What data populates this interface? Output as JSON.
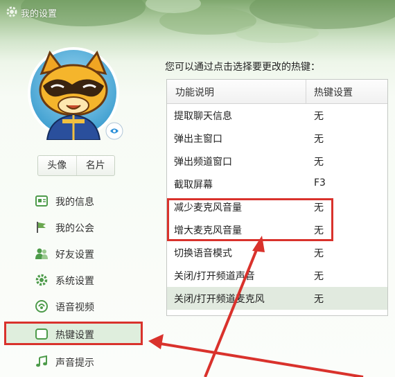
{
  "window": {
    "title": "我的设置"
  },
  "sidebar": {
    "avatar_tabs": [
      "头像",
      "名片"
    ],
    "items": [
      {
        "label": "我的信息",
        "icon": "profile-card-icon"
      },
      {
        "label": "我的公会",
        "icon": "flag-icon"
      },
      {
        "label": "好友设置",
        "icon": "friends-icon"
      },
      {
        "label": "系统设置",
        "icon": "gear-icon"
      },
      {
        "label": "语音视频",
        "icon": "voice-video-icon"
      },
      {
        "label": "热键设置",
        "icon": "keyboard-icon",
        "active": true
      },
      {
        "label": "声音提示",
        "icon": "music-note-icon"
      }
    ]
  },
  "main": {
    "hint": "您可以通过点击选择要更改的热键：",
    "columns": [
      "功能说明",
      "热键设置"
    ],
    "rows": [
      {
        "function": "提取聊天信息",
        "hotkey": "无"
      },
      {
        "function": "弹出主窗口",
        "hotkey": "无"
      },
      {
        "function": "弹出频道窗口",
        "hotkey": "无"
      },
      {
        "function": "截取屏幕",
        "hotkey": "F3"
      },
      {
        "function": "减少麦克风音量",
        "hotkey": "无"
      },
      {
        "function": "增大麦克风音量",
        "hotkey": "无"
      },
      {
        "function": "切换语音模式",
        "hotkey": "无"
      },
      {
        "function": "关闭/打开频道声音",
        "hotkey": "无"
      },
      {
        "function": "关闭/打开频道麦克风",
        "hotkey": "无",
        "selected": true
      }
    ]
  },
  "colors": {
    "highlight_red": "#d9322c",
    "selected_row": "#e1eadf"
  }
}
